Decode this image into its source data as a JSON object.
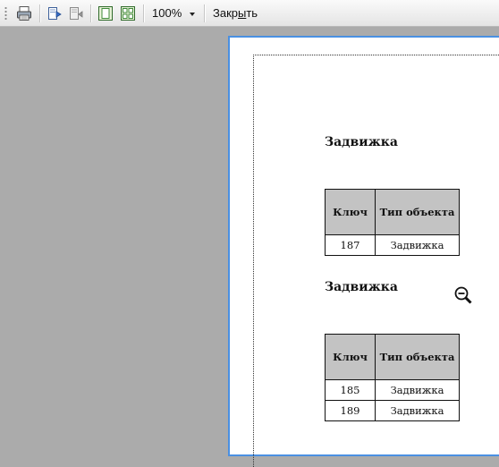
{
  "toolbar": {
    "zoom_value": "100%",
    "close_label_pre": "Закр",
    "close_label_ul": "ы",
    "close_label_post": "ть",
    "icons": [
      "print-icon",
      "page-setup-icon",
      "export-icon",
      "one-page-icon",
      "multi-page-icon"
    ]
  },
  "report": {
    "sections": [
      {
        "title": "Задвижка",
        "columns": [
          "Ключ",
          "Тип объекта"
        ],
        "rows": [
          [
            "187",
            "Задвижка"
          ]
        ]
      },
      {
        "title": "Задвижка",
        "columns": [
          "Ключ",
          "Тип объекта"
        ],
        "rows": [
          [
            "185",
            "Задвижка"
          ],
          [
            "189",
            "Задвижка"
          ]
        ]
      }
    ]
  },
  "colors": {
    "page_border": "#4a90e2",
    "background": "#ababab",
    "header_cell": "#c3c3c3"
  }
}
